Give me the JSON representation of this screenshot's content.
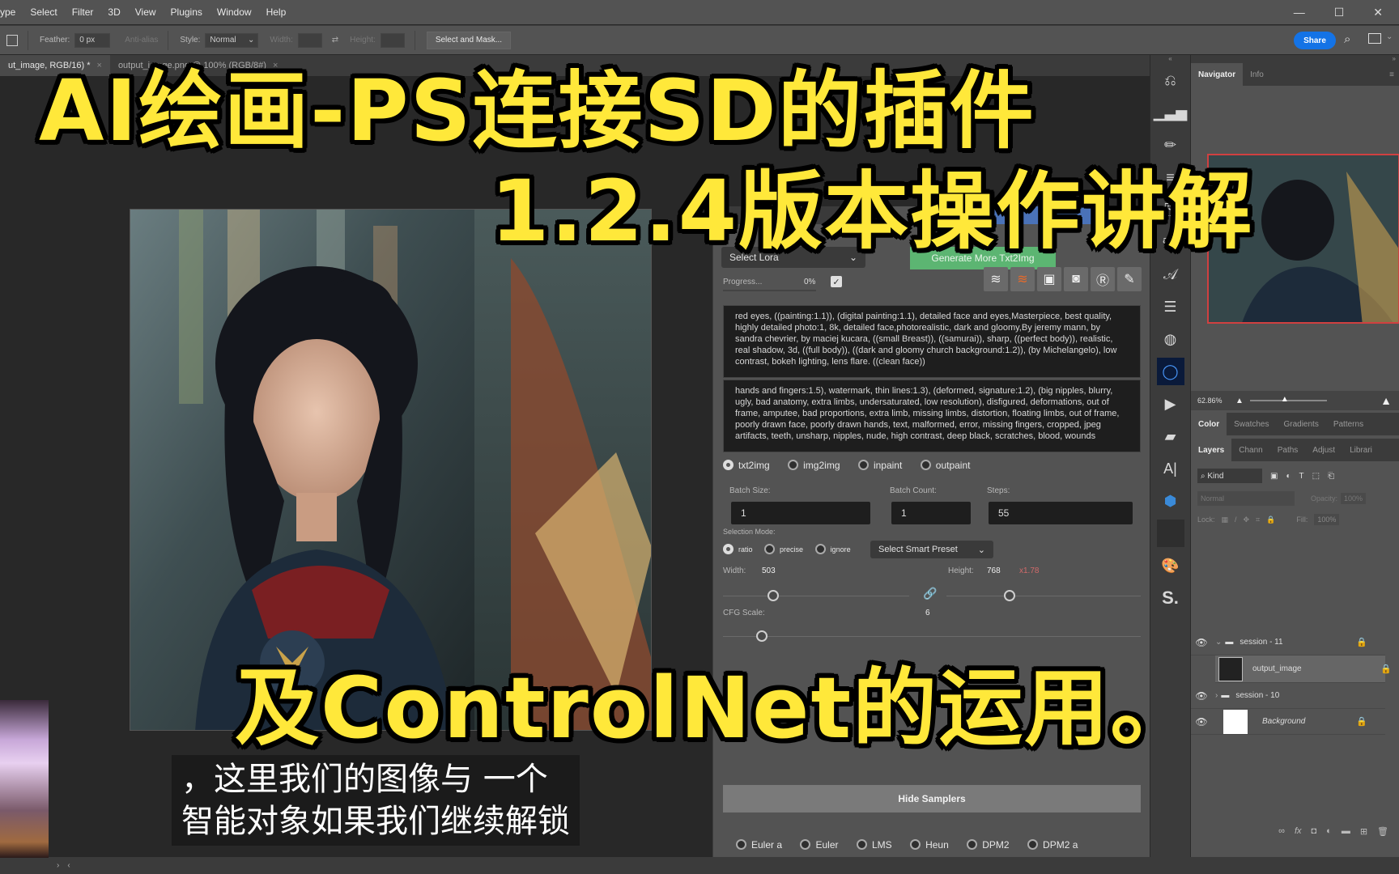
{
  "menubar": {
    "items": [
      "ype",
      "Select",
      "Filter",
      "3D",
      "View",
      "Plugins",
      "Window",
      "Help"
    ]
  },
  "window_controls": {
    "minimize": "—",
    "maximize": "☐",
    "close": "✕"
  },
  "options_bar": {
    "feather_label": "Feather:",
    "feather_value": "0 px",
    "antialias_label": "Anti-alias",
    "style_label": "Style:",
    "style_value": "Normal",
    "width_label": "Width:",
    "height_label": "Height:",
    "select_mask_label": "Select and Mask...",
    "share_label": "Share"
  },
  "doc_tabs": [
    {
      "label": "ut_image, RGB/16) *",
      "active": true
    },
    {
      "label": "output_image.png @ 100% (RGB/8#)",
      "active": false
    }
  ],
  "overlay_titles": {
    "line1": "AI绘画-PS连接SD的插件",
    "line2": "1.2.4版本操作讲解",
    "line3": "及ControlNet的运用。"
  },
  "subtitle": {
    "line1": "，这里我们的图像与 一个",
    "line2": "智能对象如果我们继续解锁"
  },
  "plugin": {
    "lora_select": "Select Lora",
    "generate_more_label": "Generate More Txt2Img",
    "progress_label": "Progress...",
    "progress_value": "0%",
    "progress_fraction": 0,
    "action_icons": [
      "layers-check-icon",
      "layers-orange-icon",
      "image-stack-icon",
      "camera-icon",
      "refresh-r-icon",
      "edit-note-icon"
    ],
    "positive_prompt": "red eyes, ((painting:1.1)), (digital painting:1.1), detailed face and eyes,Masterpiece, best quality, highly detailed photo:1, 8k, detailed face,photorealistic, dark and gloomy,By jeremy mann, by sandra chevrier, by maciej kucara, ((small Breast)), ((samurai)), sharp, ((perfect body)), realistic, real shadow, 3d, ((full body)), ((dark and gloomy church background:1.2)), (by Michelangelo), low contrast, bokeh lighting, lens flare. ((clean face))",
    "negative_prompt": "hands and fingers:1.5), watermark, thin lines:1.3), (deformed, signature:1.2), (big nipples, blurry, ugly, bad anatomy, extra limbs, undersaturated, low resolution), disfigured, deformations, out of frame, amputee, bad proportions, extra limb, missing limbs, distortion, floating limbs, out of frame, poorly drawn face, poorly drawn hands, text, malformed, error, missing fingers, cropped, jpeg artifacts, teeth, unsharp, nipples, nude, high contrast, deep black, scratches, blood, wounds",
    "modes": [
      {
        "label": "txt2img",
        "selected": true
      },
      {
        "label": "img2img",
        "selected": false
      },
      {
        "label": "inpaint",
        "selected": false
      },
      {
        "label": "outpaint",
        "selected": false
      }
    ],
    "batch_size_label": "Batch Size:",
    "batch_size": "1",
    "batch_count_label": "Batch Count:",
    "batch_count": "1",
    "steps_label": "Steps:",
    "steps": "55",
    "selection_mode_label": "Selection Mode:",
    "selection_modes": [
      {
        "label": "ratio",
        "selected": true
      },
      {
        "label": "precise",
        "selected": false
      },
      {
        "label": "ignore",
        "selected": false
      }
    ],
    "smart_preset": "Select Smart Preset",
    "width_label": "Width:",
    "width_value": "503",
    "height_label": "Height:",
    "height_value": "768",
    "ratio_hint": "x1.78",
    "cfg_label": "CFG Scale:",
    "cfg_value": "6",
    "hide_samplers_label": "Hide Samplers",
    "samplers": [
      "Euler a",
      "Euler",
      "LMS",
      "Heun",
      "DPM2",
      "DPM2 a"
    ]
  },
  "right_panel": {
    "nav_tabs": [
      "Navigator",
      "Info"
    ],
    "zoom_value": "62.86%",
    "color_tabs": [
      "Color",
      "Swatches",
      "Gradients",
      "Patterns"
    ],
    "layer_tabs": [
      "Layers",
      "Chann",
      "Paths",
      "Adjust",
      "Librari"
    ],
    "kind_filter": "Kind",
    "blend_mode": "Normal",
    "opacity_label": "Opacity:",
    "opacity_value": "100%",
    "lock_label": "Lock:",
    "fill_label": "Fill:",
    "fill_value": "100%",
    "layers": [
      {
        "name": "session - 11",
        "type": "group",
        "expanded": true
      },
      {
        "name": "output_image",
        "type": "smart-object",
        "selected": true
      },
      {
        "name": "session - 10",
        "type": "group",
        "expanded": false
      },
      {
        "name": "Background",
        "type": "background"
      }
    ]
  },
  "colors": {
    "title_yellow": "#ffe83a",
    "generate_green": "#5cb572",
    "share_blue": "#1473e6",
    "ratio_red": "#d06a6a"
  }
}
